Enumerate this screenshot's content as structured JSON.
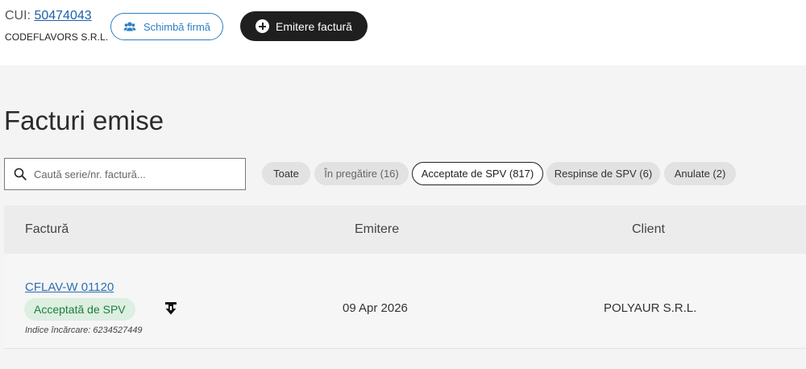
{
  "header": {
    "cui_label": "CUI:",
    "cui_value": "50474043",
    "company": "CODEFLAVORS S.R.L.",
    "switch_label": "Schimbă firmă",
    "emit_label": "Emitere factură"
  },
  "page_title": "Facturi emise",
  "search": {
    "placeholder": "Caută serie/nr. factură..."
  },
  "filters": [
    {
      "label": "Toate"
    },
    {
      "label": "În pregătire (16)"
    },
    {
      "label": "Acceptate de SPV (817)"
    },
    {
      "label": "Respinse de SPV (6)"
    },
    {
      "label": "Anulate (2)"
    }
  ],
  "table": {
    "columns": [
      "Factură",
      "Emitere",
      "Client"
    ],
    "rows": [
      {
        "invoice": "CFLAV-W 01120",
        "status": "Acceptată de SPV",
        "index_text": "Indice încărcare: 6234527449",
        "date": "09 Apr 2026",
        "client": "POLYAUR S.R.L."
      }
    ]
  },
  "colors": {
    "accent": "#2d7fc4",
    "dark_button": "#1f1f1f",
    "success_bg": "#dcefe1",
    "success_text": "#1e7d3c"
  },
  "icons": [
    "users-icon",
    "plus-circle-icon",
    "search-icon",
    "download-icon"
  ]
}
